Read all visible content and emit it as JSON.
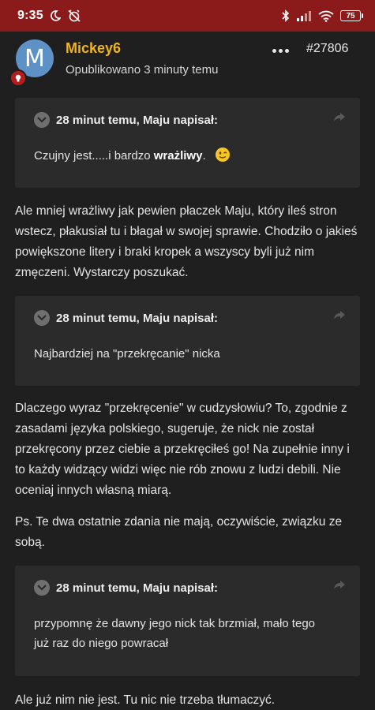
{
  "status_bar": {
    "time": "9:35",
    "battery": "75",
    "colors": {
      "background": "#8b1a1a"
    }
  },
  "post": {
    "author": "Mickey6",
    "avatar_letter": "M",
    "meta": "Opublikowano 3 minuty temu",
    "number": "#27806",
    "colors": {
      "author": "#f0b51e",
      "avatar": "#5e92c6"
    }
  },
  "quotes": [
    {
      "header": "28 minut temu, Maju napisał:",
      "text_before": "Czujny jest.....i bardzo ",
      "text_bold": "wrażliwy",
      "text_after": ".",
      "emoji": "wink-emoji"
    },
    {
      "header": "28 minut temu, Maju napisał:",
      "text": "Najbardziej na \"przekręcanie\" nicka"
    },
    {
      "header": "28 minut temu, Maju napisał:",
      "text": "przypomnę że dawny jego nick tak brzmiał, mało tego już raz do niego powracał"
    }
  ],
  "paragraphs": [
    "Ale mniej wrażliwy jak pewien płaczek Maju, który ileś stron wstecz, płakusiał tu i błagał w swojej sprawie. Chodziło o jakieś powiększone litery i braki kropek a wszyscy byli już nim zmęczeni. Wystarczy poszukać.",
    "Dlaczego wyraz \"przekręcenie\" w cudzysłowiu? To, zgodnie z zasadami języka polskiego, sugeruje, że nick nie został przekręcony przez ciebie a przekręciłeś go! Na zupełnie inny i to każdy widzący widzi więc nie rób znowu z ludzi debili. Nie oceniaj innych własną miarą.",
    "Ps. Te dwa ostatnie zdania nie mają, oczywiście, związku ze sobą.",
    "Ale już nim nie jest. Tu nic nie trzeba tłumaczyć."
  ]
}
